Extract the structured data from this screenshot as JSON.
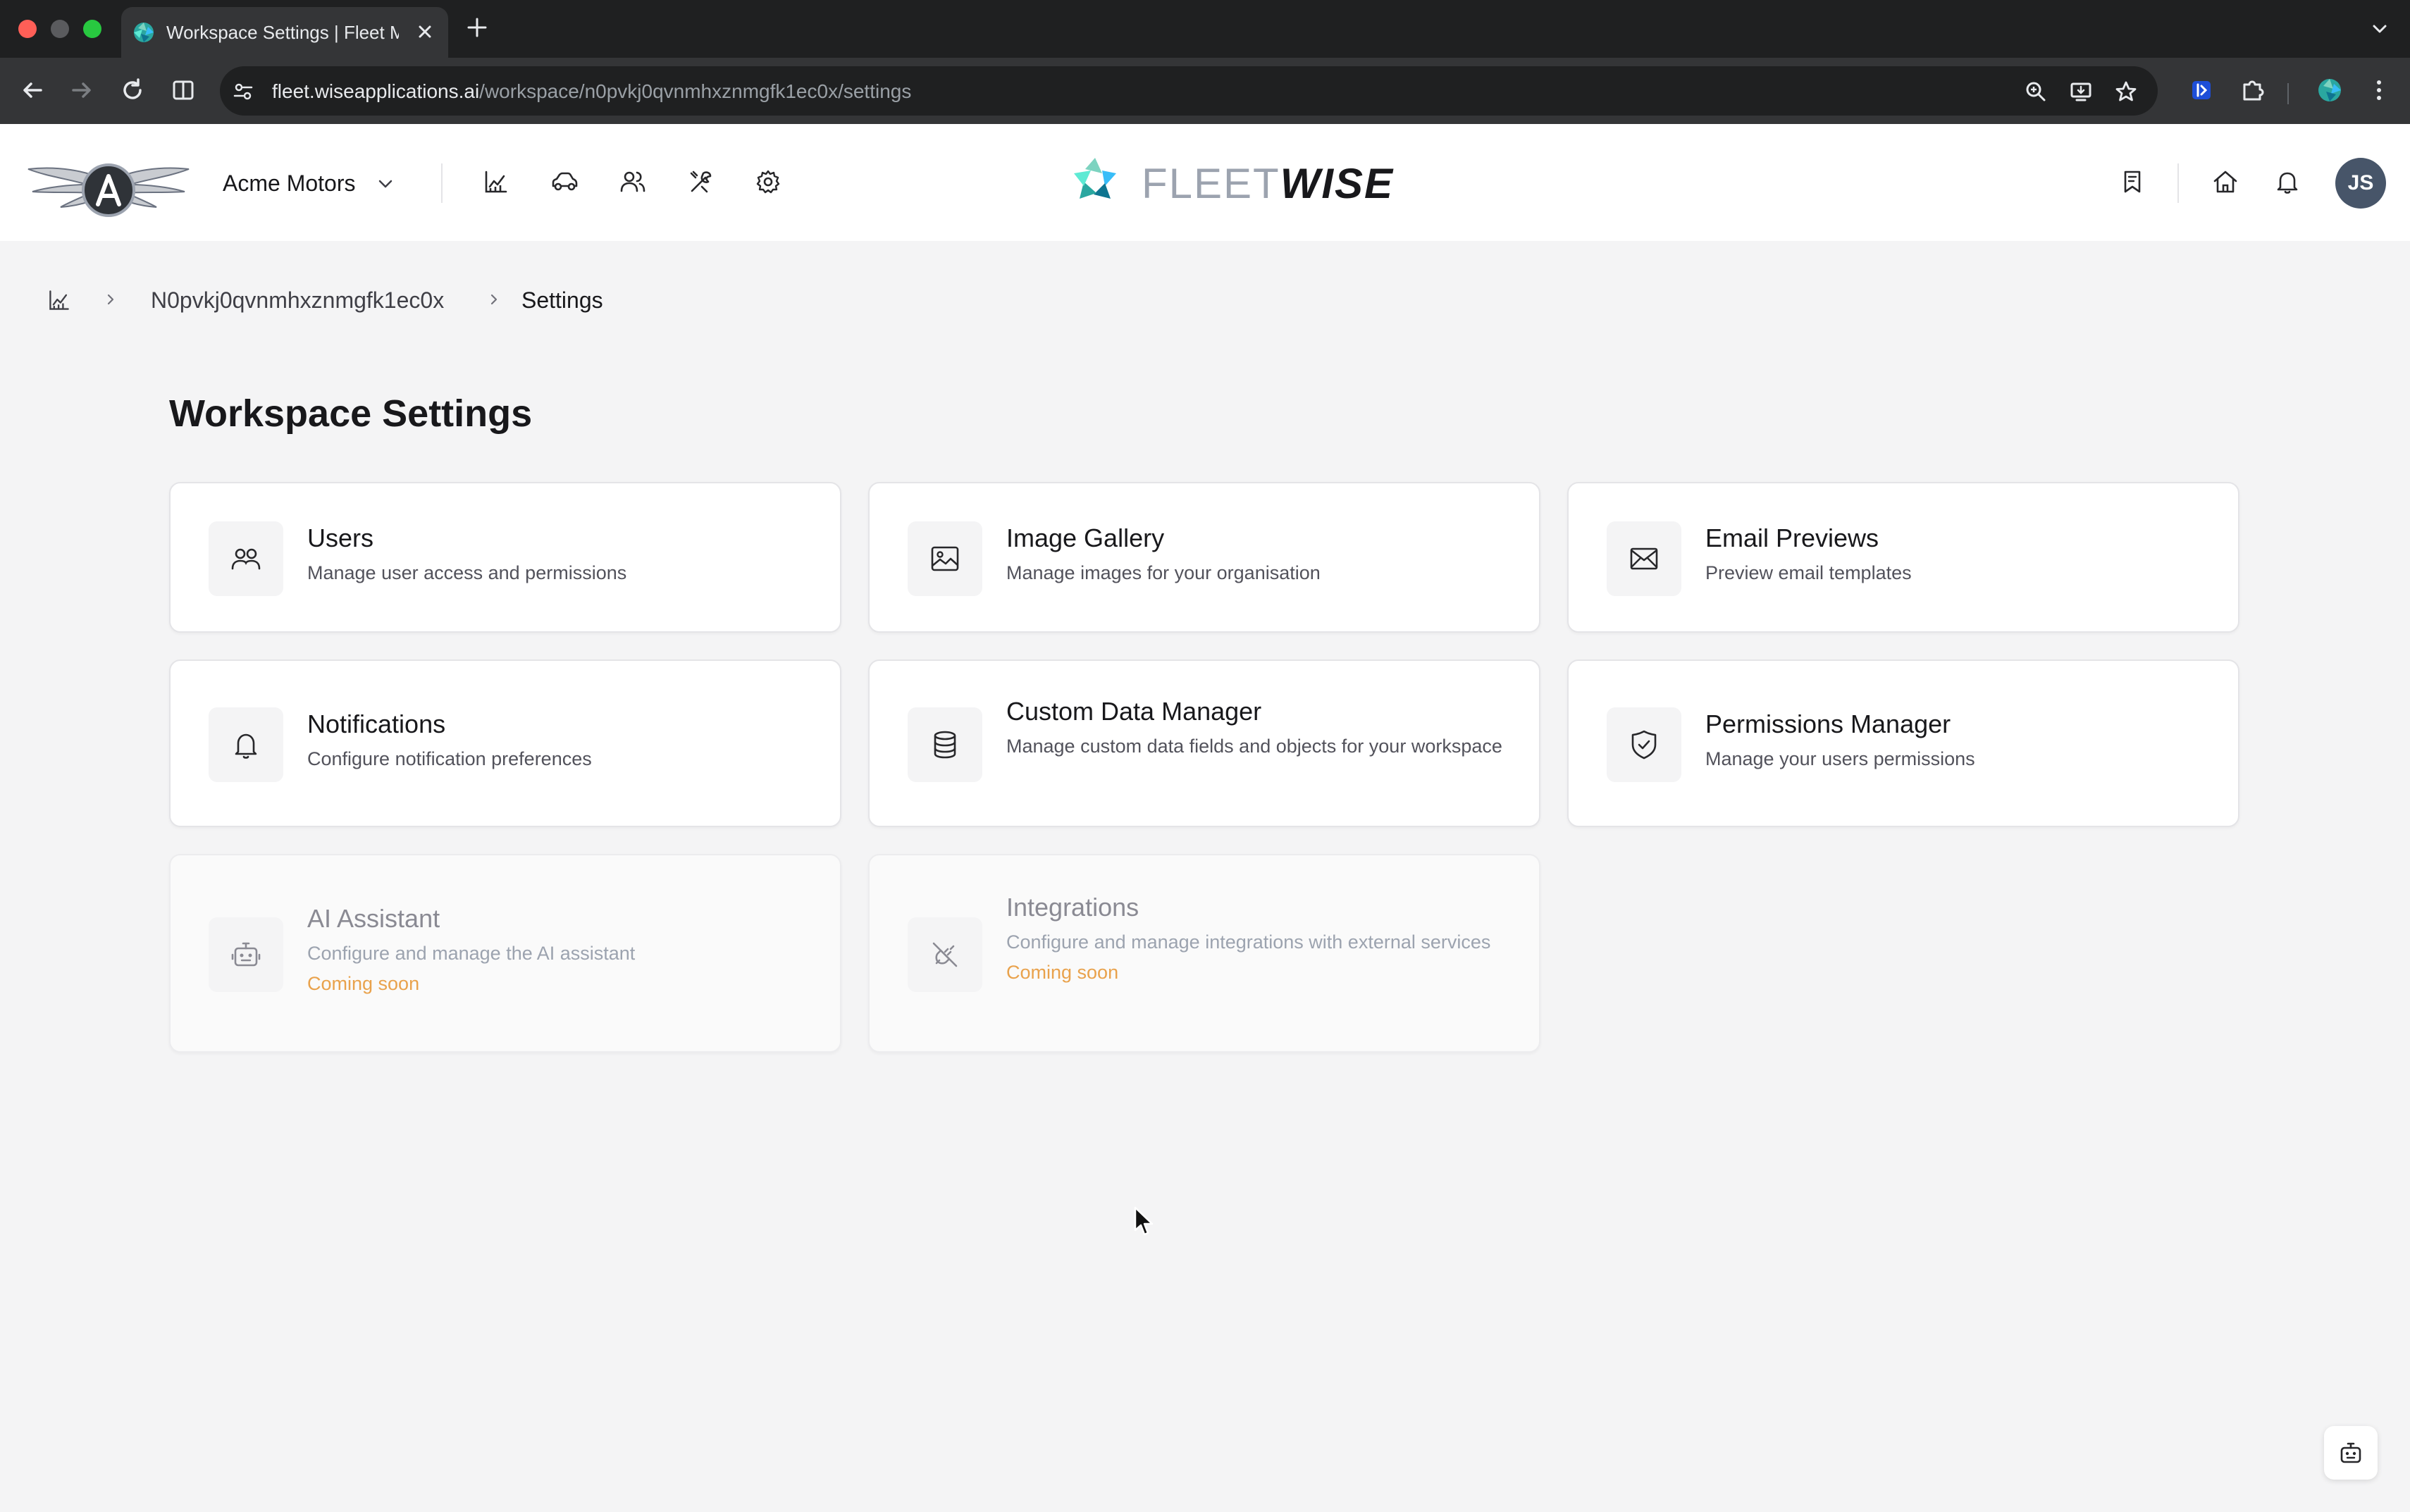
{
  "browser": {
    "tab_title": "Workspace Settings | Fleet Management",
    "url_host": "fleet.wiseapplications.ai",
    "url_path": "/workspace/n0pvkj0qvnmhxznmgfk1ec0x/settings"
  },
  "header": {
    "org_name": "Acme Motors",
    "brand_light": "FLEET",
    "brand_bold": "WISE",
    "avatar_initials": "JS",
    "nav_icons": [
      "chart-icon",
      "car-icon",
      "users-icon",
      "tools-icon",
      "gear-icon"
    ],
    "right_icons": [
      "bookmark-icon",
      "home-icon",
      "bell-icon"
    ]
  },
  "breadcrumb": {
    "workspace_id": "N0pvkj0qvnmhxznmgfk1ec0x",
    "current": "Settings"
  },
  "page": {
    "title": "Workspace Settings"
  },
  "cards": [
    {
      "title": "Users",
      "description": "Manage user access and permissions",
      "icon": "users-icon",
      "status": ""
    },
    {
      "title": "Image Gallery",
      "description": "Manage images for your organisation",
      "icon": "image-icon",
      "status": ""
    },
    {
      "title": "Email Previews",
      "description": "Preview email templates",
      "icon": "mail-icon",
      "status": ""
    },
    {
      "title": "Notifications",
      "description": "Configure notification preferences",
      "icon": "bell-icon",
      "status": ""
    },
    {
      "title": "Custom Data Manager",
      "description": "Manage custom data fields and objects for your workspace",
      "icon": "database-icon",
      "status": ""
    },
    {
      "title": "Permissions Manager",
      "description": "Manage your users permissions",
      "icon": "shield-check-icon",
      "status": ""
    },
    {
      "title": "AI Assistant",
      "description": "Configure and manage the AI assistant",
      "icon": "bot-icon",
      "status": "Coming soon"
    },
    {
      "title": "Integrations",
      "description": "Configure and manage integrations with external services",
      "icon": "plug-off-icon",
      "status": "Coming soon"
    }
  ],
  "colors": {
    "coming_soon": "#e9a24c",
    "avatar_bg": "#475569",
    "page_bg": "#f4f4f5"
  }
}
